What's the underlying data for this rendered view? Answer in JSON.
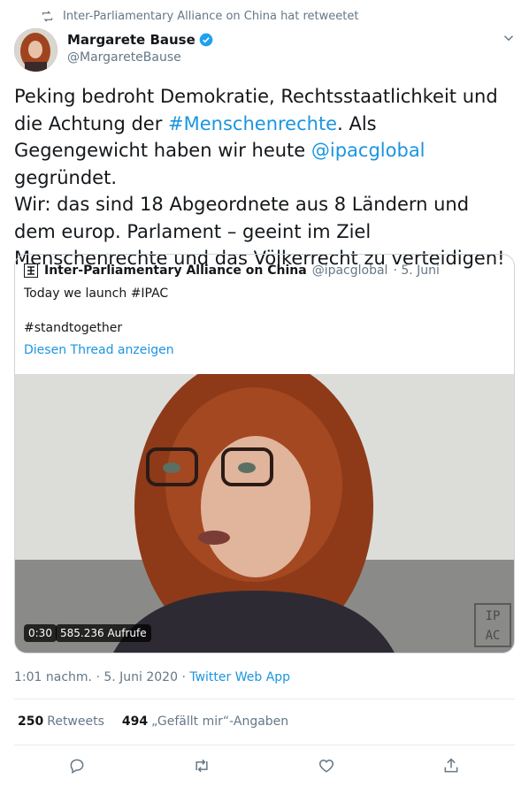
{
  "retweet_banner": "Inter-Parliamentary Alliance on China hat retweetet",
  "author": {
    "name": "Margarete Bause",
    "handle": "@MargareteBause",
    "verified": true
  },
  "tweet": {
    "p1a": "Peking bedroht Demokratie, Rechtsstaatlichkeit und die Achtung der ",
    "p1_hashtag": "#Menschenrechte",
    "p1b": ". Als Gegengewicht haben wir heute ",
    "p1_mention": "@ipacglobal",
    "p1c": " gegründet.",
    "p2": "Wir: das sind 18 Abgeordnete aus 8 Ländern und dem europ. Parlament – geeint im Ziel Menschenrechte und das Völkerrecht zu verteidigen!"
  },
  "quoted": {
    "name": "Inter-Parliamentary Alliance on China",
    "handle": "@ipacglobal",
    "date": "· 5. Juni",
    "line1": "Today we launch #IPAC",
    "line2": "#standtogether",
    "thread_link": "Diesen Thread anzeigen",
    "video": {
      "duration": "0:30",
      "views": "585.236 Aufrufe",
      "watermark": "IPAC"
    }
  },
  "meta": {
    "time": "1:01 nachm. · 5. Juni 2020 · ",
    "source": "Twitter Web App"
  },
  "stats": {
    "retweets_count": "250",
    "retweets_label": "Retweets",
    "likes_count": "494",
    "likes_label": "„Gefällt mir“-Angaben"
  },
  "actions": [
    "reply-icon",
    "retweet-icon",
    "like-icon",
    "share-icon"
  ],
  "colors": {
    "link": "#1b95e0",
    "muted": "#657786",
    "text": "#14171a",
    "verified": "#1da1f2"
  }
}
